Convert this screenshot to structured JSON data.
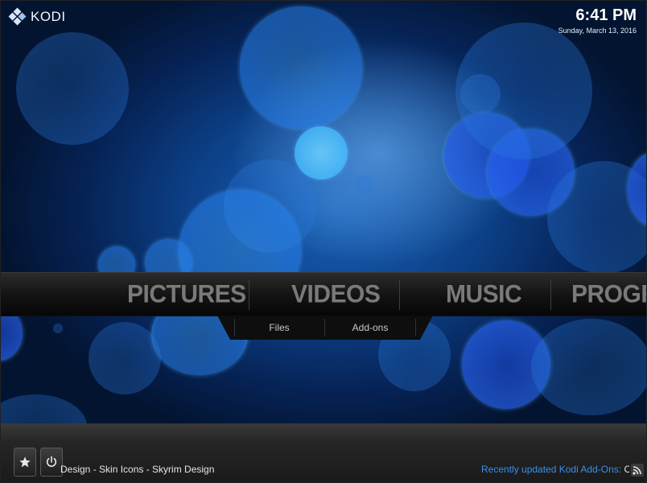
{
  "header": {
    "brand": "KODI",
    "time": "6:41 PM",
    "date": "Sunday, March 13, 2016"
  },
  "main_menu": {
    "items": [
      "PICTURES",
      "VIDEOS",
      "MUSIC",
      "PROGRA"
    ]
  },
  "sub_menu": {
    "items": [
      "Files",
      "Add-ons"
    ]
  },
  "bottom_bar": {
    "favourites_icon": "star-icon",
    "power_icon": "power-icon",
    "rss_icon": "rss-icon",
    "ticker_left": "Design - Skin Icons - Skyrim Design",
    "ticker_right_label": "Recently updated Kodi Add-Ons:",
    "ticker_right_value": " Ciner"
  },
  "colors": {
    "accent_link": "#3a8fe8",
    "background_blue": "#0c3f86",
    "menu_text": "#7a7a7a"
  }
}
